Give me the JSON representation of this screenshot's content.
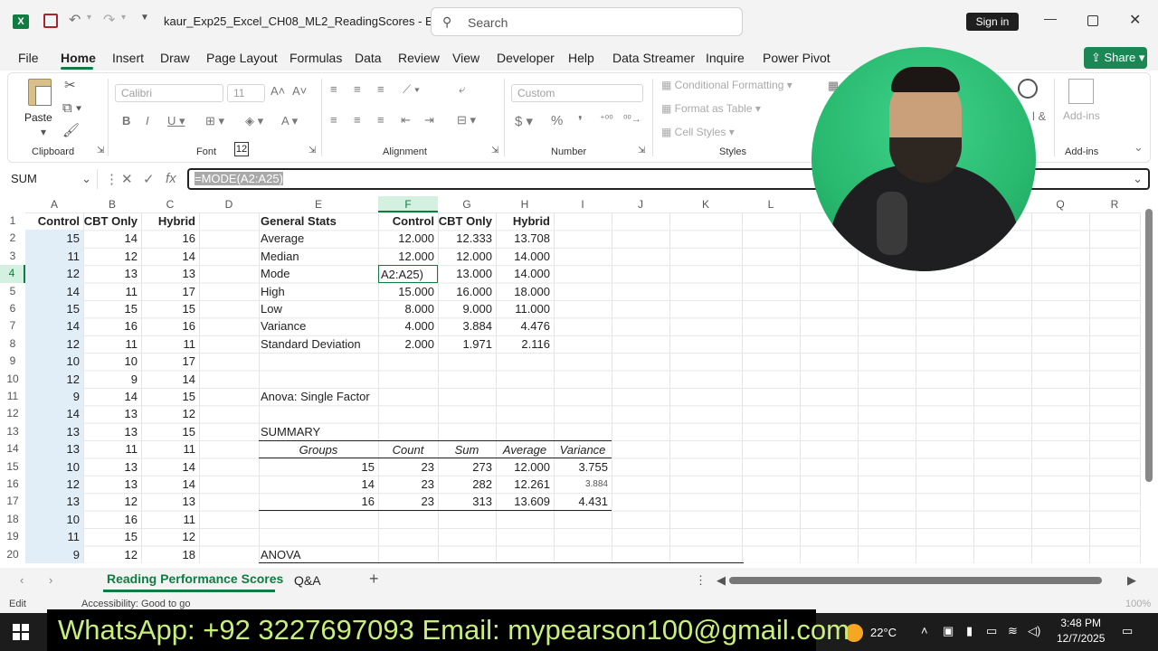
{
  "window": {
    "app_icon": "excel-icon",
    "title": "kaur_Exp25_Excel_CH08_ML2_ReadingScores  -  E...",
    "search_placeholder": "Search",
    "sign_in": "Sign in"
  },
  "menu": {
    "items": [
      "File",
      "Home",
      "Insert",
      "Draw",
      "Page Layout",
      "Formulas",
      "Data",
      "Review",
      "View",
      "Developer",
      "Help",
      "Data Streamer",
      "Inquire",
      "Power Pivot"
    ],
    "active": "Home",
    "share": "Share"
  },
  "ribbon": {
    "clipboard": {
      "paste": "Paste",
      "label": "Clipboard"
    },
    "font": {
      "name": "Calibri",
      "size": "11",
      "label": "Font",
      "badge": "12"
    },
    "alignment": {
      "label": "Alignment"
    },
    "number": {
      "format": "Custom",
      "label": "Number"
    },
    "styles": {
      "conditional": "Conditional Formatting",
      "table": "Format as Table",
      "cell": "Cell Styles",
      "label": "Styles"
    },
    "addins": {
      "label": "Add-ins",
      "button": "Add-ins",
      "partial": "l &"
    }
  },
  "formula_bar": {
    "name_box": "SUM",
    "fx": "fx",
    "formula": "=MODE(A2:A25)"
  },
  "columns": [
    "A",
    "B",
    "C",
    "D",
    "E",
    "F",
    "G",
    "H",
    "I",
    "J",
    "K",
    "L",
    "M",
    "N",
    "O",
    "P",
    "Q",
    "R"
  ],
  "rows": [
    "1",
    "2",
    "3",
    "4",
    "5",
    "6",
    "7",
    "8",
    "9",
    "10",
    "11",
    "12",
    "13",
    "14",
    "15",
    "16",
    "17",
    "18",
    "19",
    "20"
  ],
  "data_cols": {
    "A": [
      "Control",
      "15",
      "11",
      "12",
      "14",
      "15",
      "14",
      "12",
      "10",
      "12",
      "9",
      "14",
      "13",
      "13",
      "10",
      "12",
      "13",
      "10",
      "11",
      "9"
    ],
    "B": [
      "CBT Only",
      "14",
      "12",
      "13",
      "11",
      "15",
      "16",
      "11",
      "10",
      "9",
      "14",
      "13",
      "13",
      "11",
      "13",
      "13",
      "12",
      "16",
      "15",
      "12"
    ],
    "C": [
      "Hybrid",
      "16",
      "14",
      "13",
      "17",
      "15",
      "16",
      "11",
      "17",
      "14",
      "15",
      "12",
      "15",
      "11",
      "14",
      "14",
      "13",
      "11",
      "12",
      "18"
    ]
  },
  "stats": {
    "header": [
      "General Stats",
      "Control",
      "CBT Only",
      "Hybrid"
    ],
    "rows": [
      [
        "Average",
        "12.000",
        "12.333",
        "13.708"
      ],
      [
        "Median",
        "12.000",
        "12.000",
        "14.000"
      ],
      [
        "Mode",
        "A2:A25)",
        "13.000",
        "14.000"
      ],
      [
        "High",
        "15.000",
        "16.000",
        "18.000"
      ],
      [
        "Low",
        "8.000",
        "9.000",
        "11.000"
      ],
      [
        "Variance",
        "4.000",
        "3.884",
        "4.476"
      ],
      [
        "Standard Deviation",
        "2.000",
        "1.971",
        "2.116"
      ]
    ]
  },
  "anova": {
    "title": "Anova: Single Factor",
    "summary": "SUMMARY",
    "headers": [
      "Groups",
      "Count",
      "Sum",
      "Average",
      "Variance"
    ],
    "rows": [
      [
        "15",
        "23",
        "273",
        "12.000",
        "3.755"
      ],
      [
        "14",
        "23",
        "282",
        "12.261",
        "3.884"
      ],
      [
        "16",
        "23",
        "313",
        "13.609",
        "4.431"
      ]
    ],
    "anova_label": "ANOVA"
  },
  "sheets": {
    "tabs": [
      "Reading Performance Scores",
      "Q&A"
    ],
    "active": "Reading Performance Scores",
    "add": "+"
  },
  "status": {
    "mode": "Edit",
    "accessibility": "Accessibility: Good to go",
    "zoom": "100%"
  },
  "banner": "WhatsApp: +92 3227697093  Email: mypearson100@gmail.com",
  "taskbar": {
    "temp": "22°C",
    "time": "3:48 PM",
    "date": "12/7/2025"
  }
}
